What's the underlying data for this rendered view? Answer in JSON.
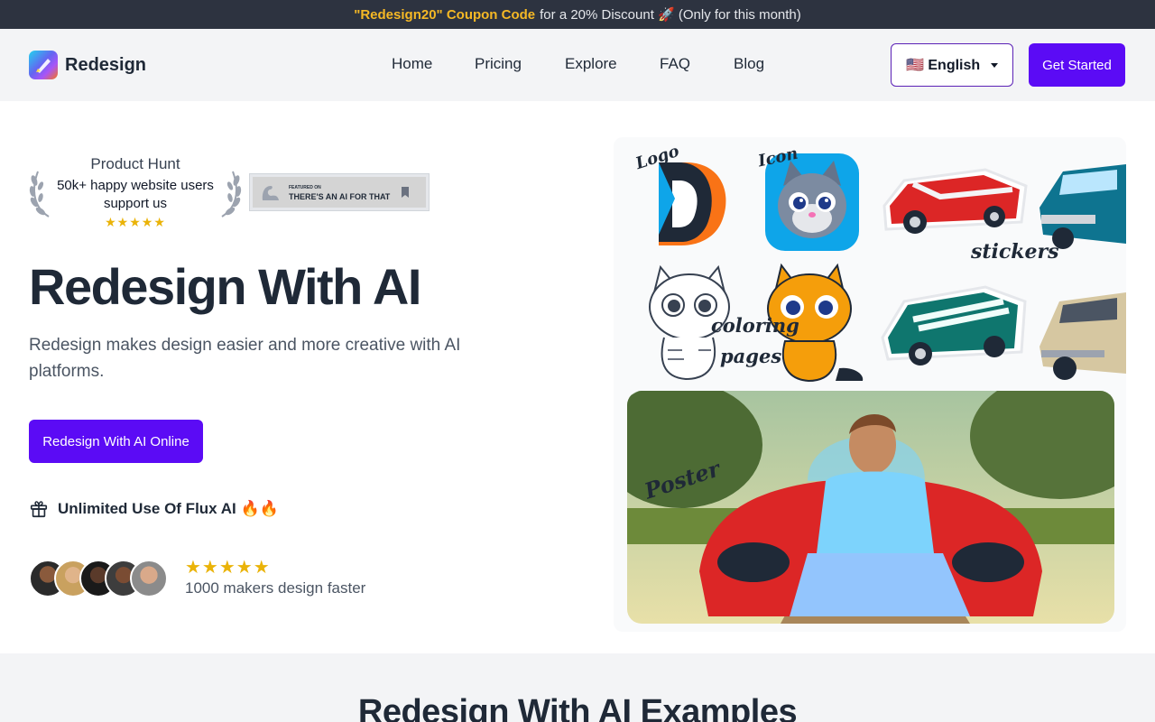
{
  "announcement": {
    "code": "\"Redesign20\" Coupon Code",
    "text": "for a 20% Discount 🚀 (Only for this month)"
  },
  "header": {
    "brand": "Redesign",
    "nav": [
      {
        "label": "Home"
      },
      {
        "label": "Pricing"
      },
      {
        "label": "Explore"
      },
      {
        "label": "FAQ"
      },
      {
        "label": "Blog"
      }
    ],
    "language": "🇺🇸 English",
    "cta": "Get Started"
  },
  "hero": {
    "badge_title": "Product Hunt",
    "badge_sub": "50k+ happy website users support us",
    "badge_stars": "★★★★★",
    "aiforthat_featured": "FEATURED ON",
    "aiforthat_label": "THERE'S AN AI FOR THAT",
    "title": "Redesign With AI",
    "description": "Redesign makes design easier and more creative with AI platforms.",
    "cta": "Redesign With AI Online",
    "flux": "Unlimited Use Of Flux AI 🔥🔥",
    "rating_stars": "★★★★★",
    "rating_text": "1000 makers design faster"
  },
  "gallery": {
    "labels": {
      "logo": "Logo",
      "icon": "Icon",
      "stickers": "stickers",
      "coloring": "coloring",
      "pages": "pages",
      "poster": "Poster"
    }
  },
  "examples": {
    "title": "Redesign With AI Examples"
  },
  "colors": {
    "brand": "#5b0bf5",
    "announce_bg": "#2d3340",
    "coupon": "#f5b825",
    "stars": "#eab308"
  }
}
